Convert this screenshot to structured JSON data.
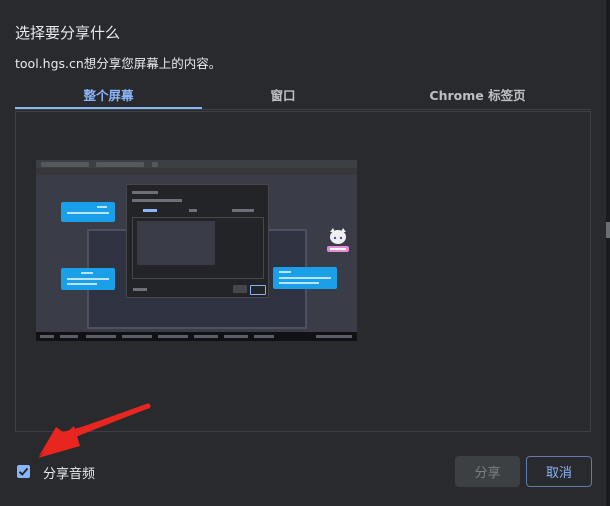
{
  "dialog": {
    "title": "选择要分享什么",
    "subtitle": "tool.hgs.cn想分享您屏幕上的内容。"
  },
  "tabs": [
    {
      "label": "整个屏幕",
      "active": true
    },
    {
      "label": "窗口",
      "active": false
    },
    {
      "label": "Chrome 标签页",
      "active": false
    }
  ],
  "audio": {
    "label": "分享音频",
    "checked": true
  },
  "buttons": {
    "share": "分享",
    "cancel": "取消"
  },
  "colors": {
    "accent": "#8ab4f8",
    "annotation_arrow": "#e8261f",
    "dialog_bg": "#292a2d"
  },
  "icons": {
    "annotation": "red-arrow-icon",
    "checkbox": "checkmark-icon"
  }
}
